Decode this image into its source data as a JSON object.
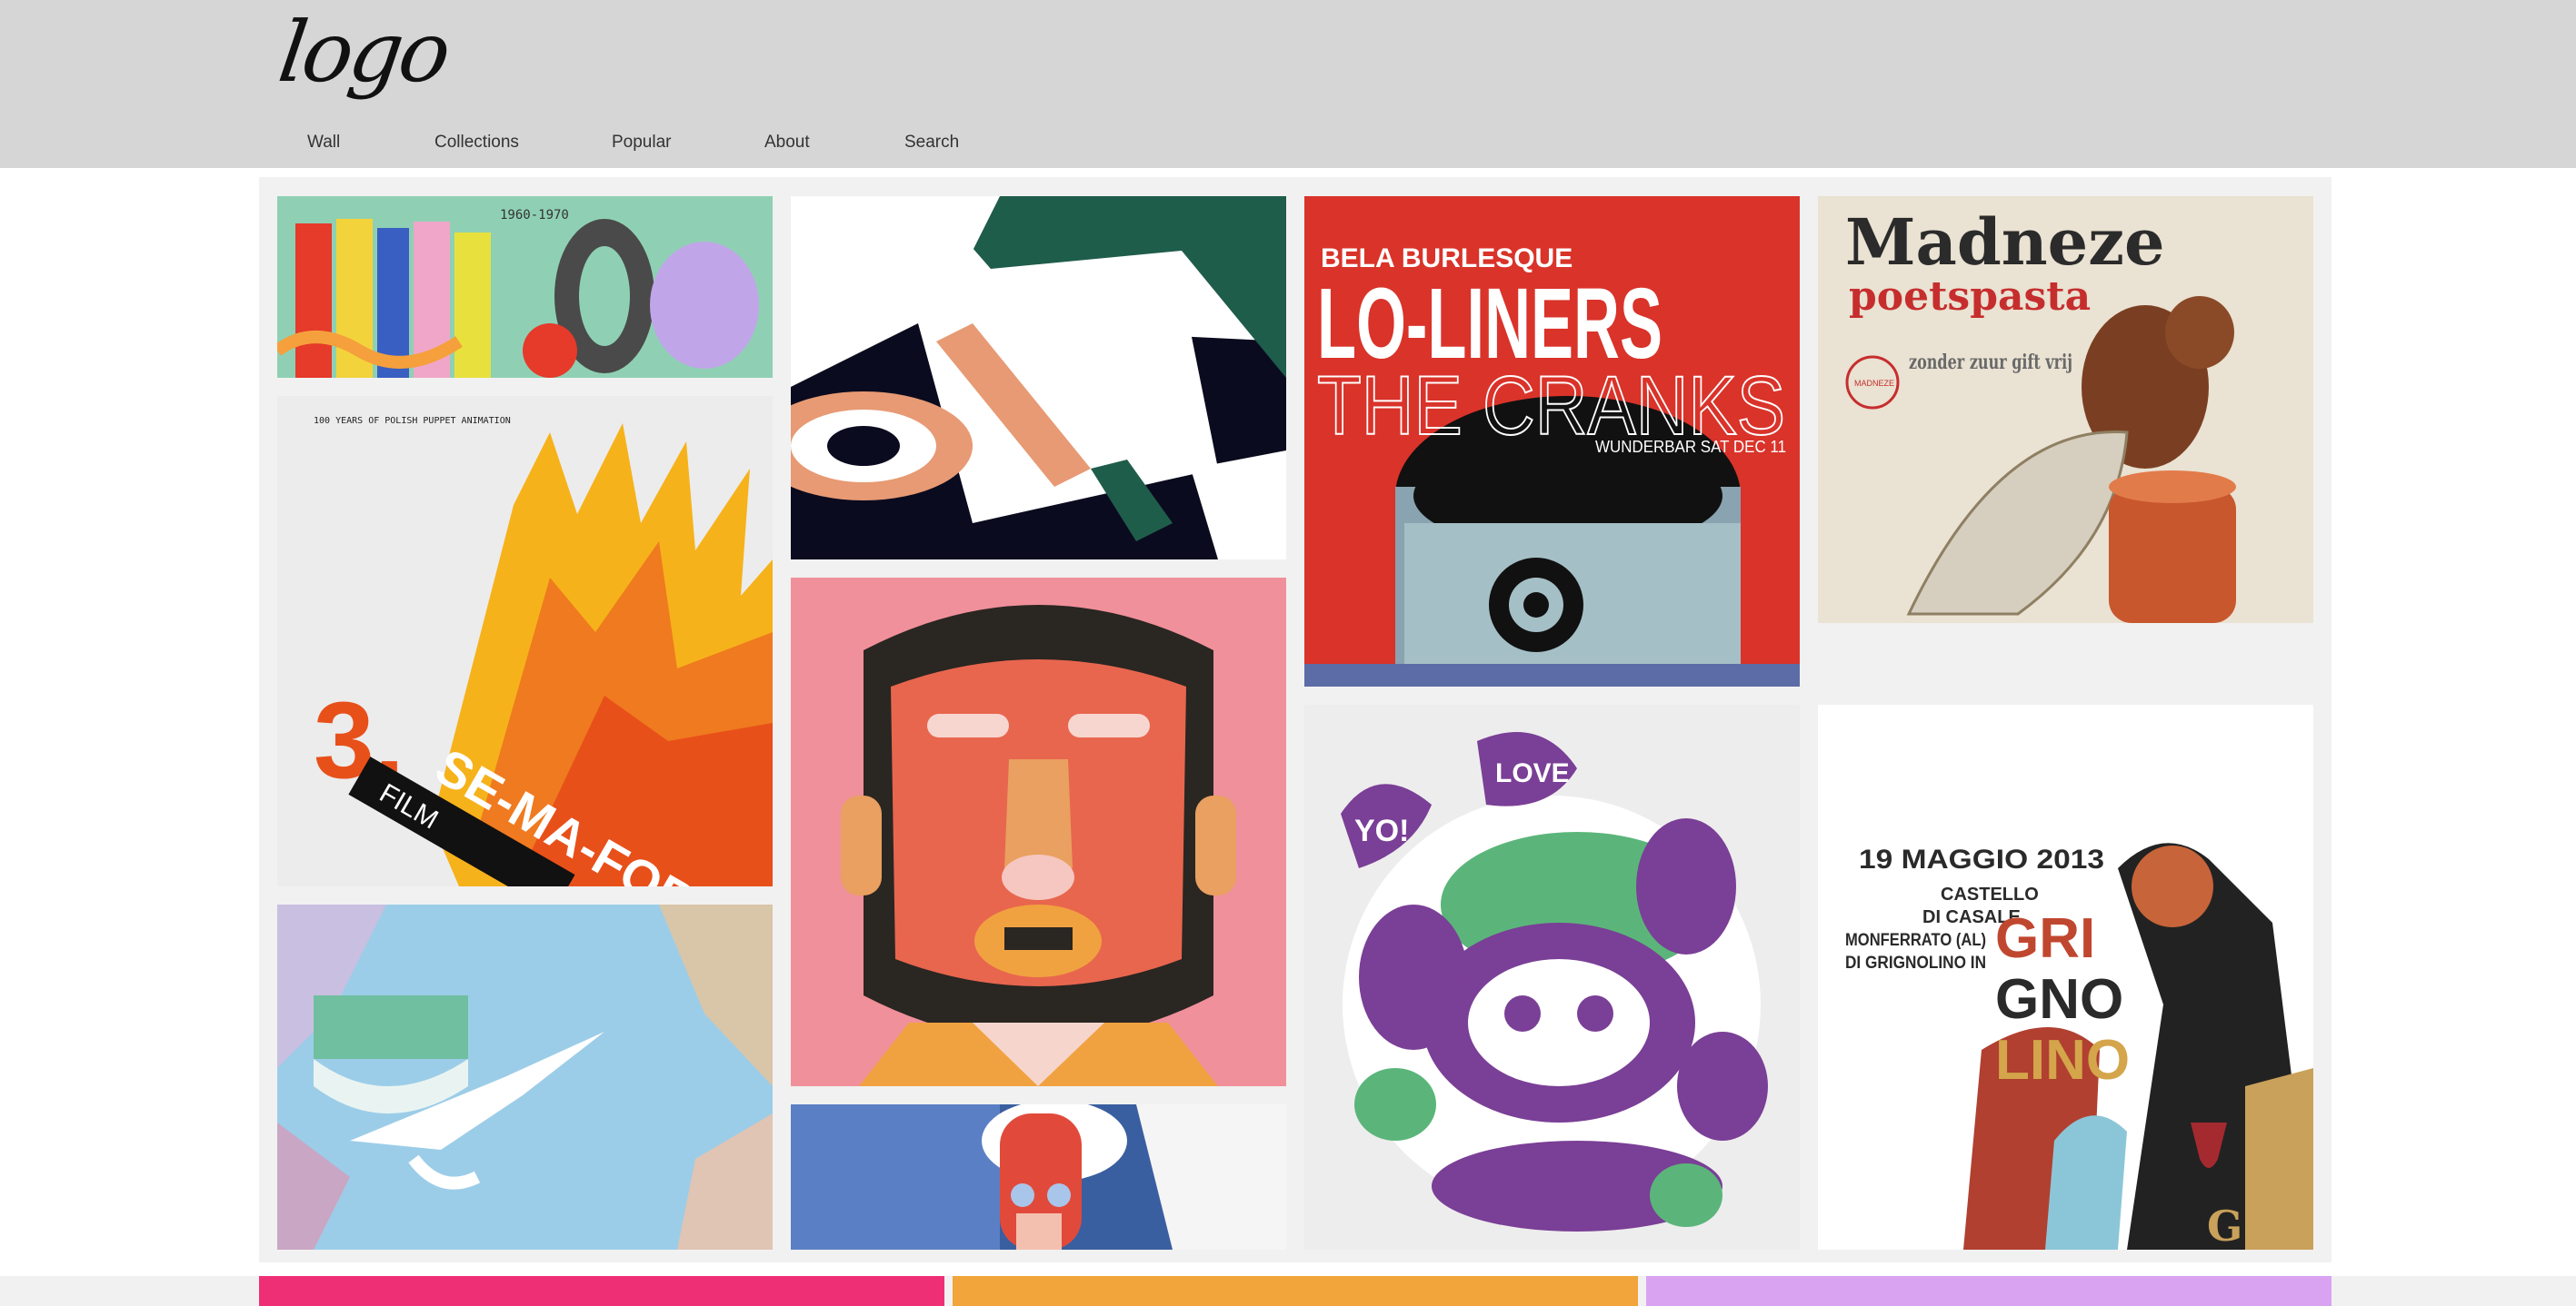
{
  "header": {
    "logo_text": "logo",
    "nav": [
      {
        "label": "Wall"
      },
      {
        "label": "Collections"
      },
      {
        "label": "Popular"
      },
      {
        "label": "About"
      },
      {
        "label": "Search"
      }
    ]
  },
  "tiles": {
    "alphabet_poster": {
      "text": "1960-1970"
    },
    "airplane_poster": {},
    "polish_animation": {
      "tagline": "100 YEARS OF POLISH PUPPET ANIMATION",
      "number": "3.",
      "title": "SE-MA-FOR",
      "subtitle": "FILM"
    },
    "pelican_river": {},
    "lo_liners": {
      "line1": "BELA BURLESQUE",
      "line2": "LO-LINERS",
      "line3": "THE CRANKS",
      "line4": "WUNDERBAR SAT DEC 11"
    },
    "madneze": {
      "brand": "Madneze",
      "product": "poetspasta",
      "claim": "zonder zuur gift vrij",
      "seal": "MADNEZE"
    },
    "face_portrait": {},
    "graffiti_character": {
      "bubble1": "YO!",
      "bubble2": "LOVE"
    },
    "grignolino": {
      "date": "19 MAGGIO 2013",
      "place1": "CASTELLO",
      "place2": "DI CASALE",
      "place3": "MONFERRATO (AL)",
      "place4": "DI GRIGNOLINO IN",
      "word1": "GRI",
      "word2": "GNO",
      "word3": "LINO",
      "glass_letter": "G"
    },
    "pop_head": {}
  },
  "colors": {
    "header_bg": "#d6d6d6",
    "gallery_bg": "#f1f1f1",
    "strip_pink": "#ee2f75",
    "strip_orange": "#f1a53a",
    "strip_lilac": "#d9a3f2"
  }
}
